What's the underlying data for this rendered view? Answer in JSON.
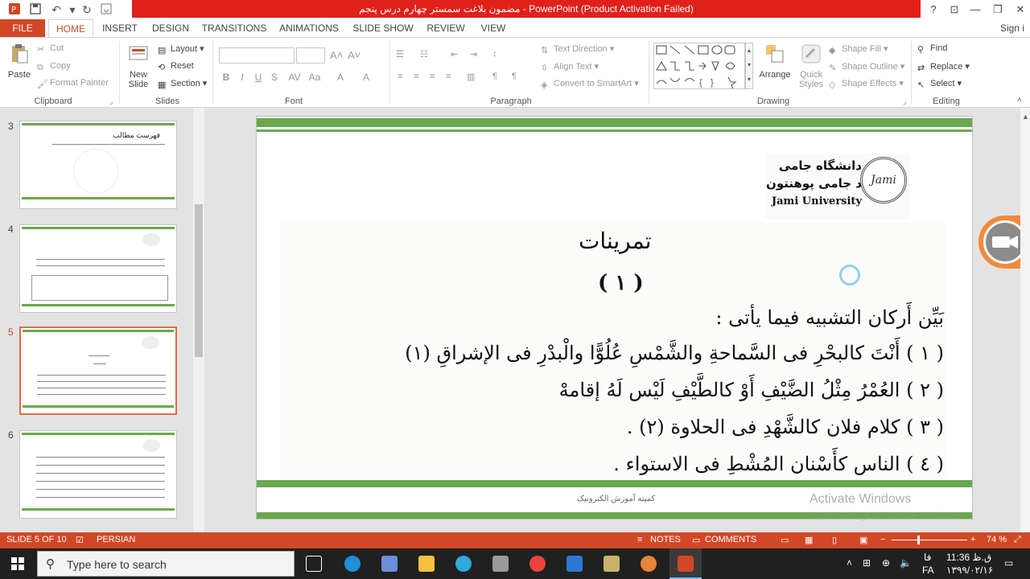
{
  "window": {
    "title": "مضمون بلاغت سمستر چهارم درس پنجم  -  PowerPoint (Product Activation Failed)",
    "help": "?",
    "sign_in": "Sign i"
  },
  "tabs": [
    "FILE",
    "HOME",
    "INSERT",
    "DESIGN",
    "TRANSITIONS",
    "ANIMATIONS",
    "SLIDE SHOW",
    "REVIEW",
    "VIEW"
  ],
  "ribbon": {
    "clipboard": {
      "paste": "Paste",
      "cut": "Cut",
      "copy": "Copy",
      "format_painter": "Format Painter",
      "label": "Clipboard"
    },
    "slides": {
      "new_slide_1": "New",
      "new_slide_2": "Slide",
      "layout": "Layout",
      "reset": "Reset",
      "section": "Section",
      "label": "Slides"
    },
    "font": {
      "label": "Font",
      "bold": "B",
      "italic": "I",
      "underline": "U",
      "strike": "S",
      "char_spacing": "AV",
      "case": "Aa",
      "clear": "A",
      "color": "A"
    },
    "paragraph": {
      "text_direction": "Text Direction",
      "align_text": "Align Text",
      "convert_smartart": "Convert to SmartArt",
      "label": "Paragraph"
    },
    "drawing": {
      "arrange": "Arrange",
      "quick_styles_1": "Quick",
      "quick_styles_2": "Styles",
      "shape_fill": "Shape Fill",
      "shape_outline": "Shape Outline",
      "shape_effects": "Shape Effects",
      "label": "Drawing"
    },
    "editing": {
      "find": "Find",
      "replace": "Replace",
      "select": "Select",
      "label": "Editing"
    }
  },
  "thumbnails": [
    {
      "num": "3",
      "title": "فهرست مطالب"
    },
    {
      "num": "4"
    },
    {
      "num": "5"
    },
    {
      "num": "6"
    }
  ],
  "slide": {
    "logo_line1": "دانشگاه جامی",
    "logo_line2": "د جامی پوهنتون",
    "logo_line3": "Jami University",
    "seal_text": "Jami",
    "title": "تمرینات",
    "number": "( ١ )",
    "instruction": "بَيِّن أَركان التشبيه فيما يأتى :",
    "lines": [
      "( ١ ) أَنْتَ كالبحْرِ فى السَّماحةِ والشَّمْسِ عُلُوًّا والْبدْرِ فى الإشراقِ (١)",
      "( ٢ ) العُمْرُ مِثْلُ الضَّيْفِ أَوْ كالطَّيْفِ لَيْس لَهُ إقامهْ",
      "( ٣ ) كلام فلان كالشَّهْدِ فى الحلاوة (٢) .",
      "( ٤ ) الناس كأَسْنان المُشْطِ فى الاستواء ."
    ],
    "footer": "کمیته آموزش الکترونیک"
  },
  "status": {
    "slide_of": "SLIDE 5 OF 10",
    "language": "PERSIAN",
    "notes": "NOTES",
    "comments": "COMMENTS",
    "zoom": "74 %"
  },
  "activation": {
    "line1": "Activate Windows",
    "line2": "Go to Settings to activate Windows."
  },
  "taskbar": {
    "search_placeholder": "Type here to search",
    "time": "11:36 ق.ظ",
    "date": "۱۳۹۹/۰۲/۱۶",
    "lang": "فا",
    "lang2": "FA"
  },
  "colors": {
    "accent": "#d24726",
    "title_red": "#e0201b",
    "green_band": "#6aa84f"
  }
}
